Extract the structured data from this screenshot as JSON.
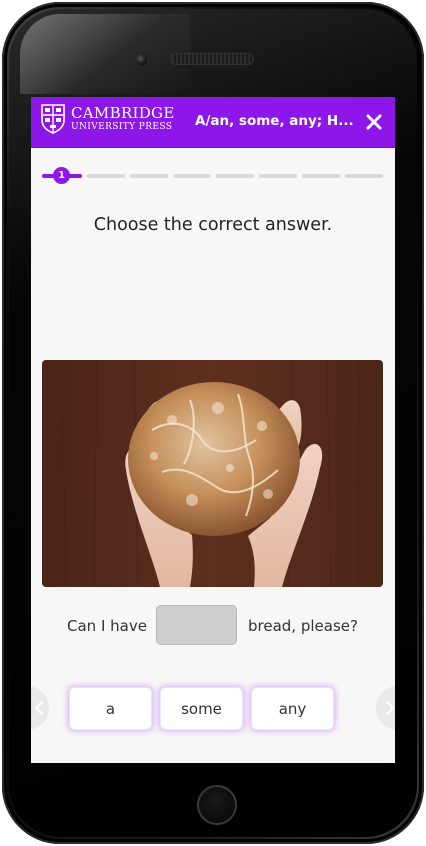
{
  "header": {
    "logo_line1": "Cambridge",
    "logo_line2": "University Press",
    "title": "A/an, some, any; H..."
  },
  "progress": {
    "current_step": "1",
    "total_steps": 8
  },
  "question": {
    "instruction": "Choose the correct answer.",
    "sentence_before": "Can I have",
    "sentence_after": "bread, please?"
  },
  "options": [
    "a",
    "some",
    "any"
  ],
  "colors": {
    "accent": "#8d16e8",
    "background": "#f8f7f7",
    "blank": "#cfcfcf"
  },
  "icons": {
    "close": "close-icon",
    "prev": "chevron-left-icon",
    "next": "chevron-right-icon",
    "crest": "cambridge-crest-icon"
  }
}
